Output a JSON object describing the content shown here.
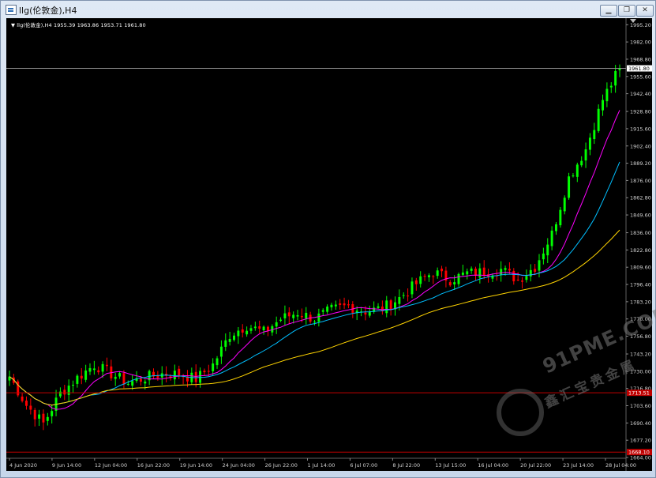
{
  "window": {
    "title": "llg(伦敦金),H4",
    "minimize_label": "▁",
    "restore_label": "❐",
    "close_label": "✕"
  },
  "chart_info": {
    "symbol_label": "llg(伦敦金),H4",
    "ohlc_text": "1955.39 1963.86 1953.71 1961.80"
  },
  "watermark": {
    "line1": "91PME.COM",
    "line2": "鑫汇宝贵金属"
  },
  "colors": {
    "background": "#000000",
    "bull_candle": "#00ff00",
    "bear_candle": "#ff0000",
    "ma_fast": "#ff00ff",
    "ma_mid": "#00bfff",
    "ma_slow": "#ffd400",
    "level_line": "#c00000",
    "price_line": "#8c8c8c"
  },
  "chart_data": {
    "type": "candlestick",
    "ylim": [
      1664.0,
      1999.0
    ],
    "y_ticks": [
      "1995.20",
      "1982.00",
      "1968.80",
      "1955.60",
      "1942.40",
      "1928.80",
      "1915.60",
      "1902.40",
      "1889.20",
      "1876.00",
      "1862.80",
      "1849.60",
      "1836.00",
      "1822.80",
      "1809.60",
      "1796.40",
      "1783.20",
      "1770.00",
      "1756.80",
      "1743.20",
      "1730.00",
      "1716.80",
      "1703.60",
      "1690.40",
      "1677.20",
      "1664.00"
    ],
    "x_ticks": [
      "4 Jun 2020",
      "9 Jun 14:00",
      "12 Jun 04:00",
      "16 Jun 22:00",
      "19 Jun 14:00",
      "24 Jun 04:00",
      "26 Jun 22:00",
      "1 Jul 14:00",
      "6 Jul 07:00",
      "8 Jul 22:00",
      "13 Jul 15:00",
      "16 Jul 04:00",
      "20 Jul 22:00",
      "23 Jul 14:00",
      "28 Jul 04:00"
    ],
    "current_price": {
      "value": 1961.8,
      "label": "1961.80"
    },
    "horizontal_levels": [
      {
        "value": 1713.5,
        "label": "1713.51"
      },
      {
        "value": 1668.1,
        "label": "1668.10"
      }
    ],
    "anchor_closes": [
      1726,
      1704,
      1690,
      1713,
      1725,
      1735,
      1728,
      1721,
      1725,
      1728,
      1728,
      1724,
      1735,
      1758,
      1765,
      1760,
      1770,
      1775,
      1770,
      1777,
      1780,
      1776,
      1778,
      1786,
      1797,
      1806,
      1800,
      1805,
      1806,
      1808,
      1800,
      1810,
      1835,
      1878,
      1900,
      1938,
      1961.8
    ],
    "bars_per_anchor": 4,
    "moving_averages": [
      {
        "period": 10,
        "color": "#ff00ff"
      },
      {
        "period": 20,
        "color": "#00bfff"
      },
      {
        "period": 50,
        "color": "#ffd400"
      }
    ]
  }
}
